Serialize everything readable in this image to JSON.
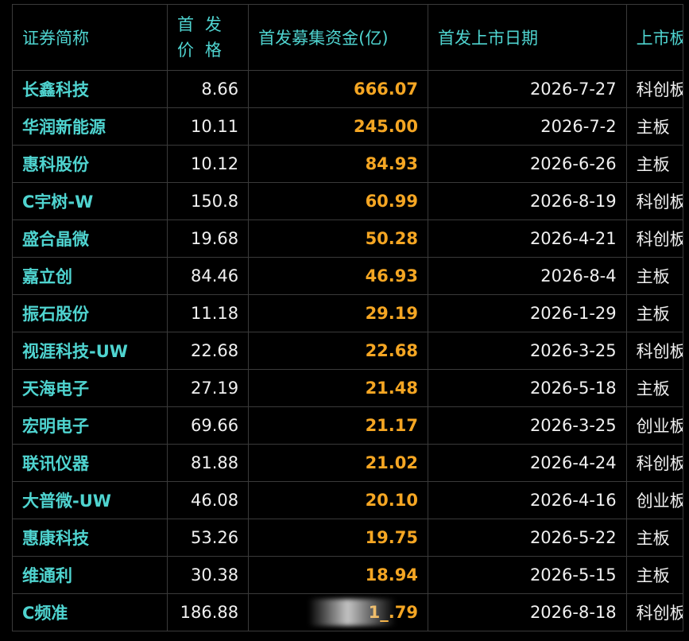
{
  "header": {
    "name": "证券简称",
    "price": "首发价格",
    "funds": "首发募集资金(亿)",
    "date": "首发上市日期",
    "board": "上市板"
  },
  "rows": [
    {
      "name": "长鑫科技",
      "price": "8.66",
      "funds": "666.07",
      "date": "2026-7-27",
      "board": "科创板"
    },
    {
      "name": "华润新能源",
      "price": "10.11",
      "funds": "245.00",
      "date": "2026-7-2",
      "board": "主板"
    },
    {
      "name": "惠科股份",
      "price": "10.12",
      "funds": "84.93",
      "date": "2026-6-26",
      "board": "主板"
    },
    {
      "name": "C宇树-W",
      "price": "150.8",
      "funds": "60.99",
      "date": "2026-8-19",
      "board": "科创板"
    },
    {
      "name": "盛合晶微",
      "price": "19.68",
      "funds": "50.28",
      "date": "2026-4-21",
      "board": "科创板"
    },
    {
      "name": "嘉立创",
      "price": "84.46",
      "funds": "46.93",
      "date": "2026-8-4",
      "board": "主板"
    },
    {
      "name": "振石股份",
      "price": "11.18",
      "funds": "29.19",
      "date": "2026-1-29",
      "board": "主板"
    },
    {
      "name": "视涯科技-UW",
      "price": "22.68",
      "funds": "22.68",
      "date": "2026-3-25",
      "board": "科创板"
    },
    {
      "name": "天海电子",
      "price": "27.19",
      "funds": "21.48",
      "date": "2026-5-18",
      "board": "主板"
    },
    {
      "name": "宏明电子",
      "price": "69.66",
      "funds": "21.17",
      "date": "2026-3-25",
      "board": "创业板"
    },
    {
      "name": "联讯仪器",
      "price": "81.88",
      "funds": "21.02",
      "date": "2026-4-24",
      "board": "科创板"
    },
    {
      "name": "大普微-UW",
      "price": "46.08",
      "funds": "20.10",
      "date": "2026-4-16",
      "board": "创业板"
    },
    {
      "name": "惠康科技",
      "price": "53.26",
      "funds": "19.75",
      "date": "2026-5-22",
      "board": "主板"
    },
    {
      "name": "维通利",
      "price": "30.38",
      "funds": "18.94",
      "date": "2026-5-15",
      "board": "主板"
    },
    {
      "name": "C频准",
      "price": "186.88",
      "funds": "1_.79",
      "date": "2026-8-18",
      "board": "科创板"
    }
  ],
  "colors": {
    "header": "#4fd4d0",
    "name": "#4fd4d0",
    "funds": "#f5a623",
    "text": "#f0f0f0",
    "background": "#000000"
  }
}
